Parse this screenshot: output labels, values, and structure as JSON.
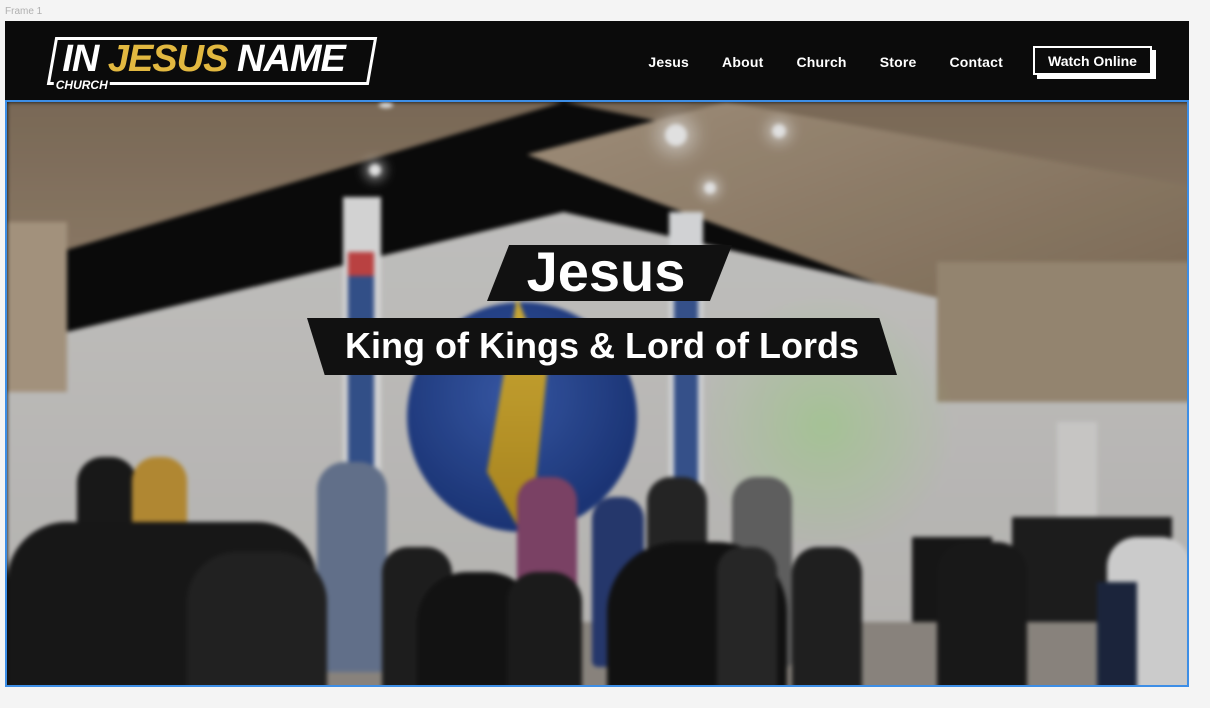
{
  "canvas": {
    "frame_label": "Frame 1"
  },
  "header": {
    "logo": {
      "word1": "IN",
      "word2": "JESUS",
      "word3": "NAME",
      "sub": "CHURCH"
    },
    "nav": [
      "Jesus",
      "About",
      "Church",
      "Store",
      "Contact"
    ],
    "cta_label": "Watch Online"
  },
  "hero": {
    "title": "Jesus",
    "subtitle": "King of Kings & Lord of Lords"
  },
  "colors": {
    "accent_gold": "#e2b840",
    "header_bg": "#0b0b0b",
    "selection_blue": "#3d8ee6"
  }
}
